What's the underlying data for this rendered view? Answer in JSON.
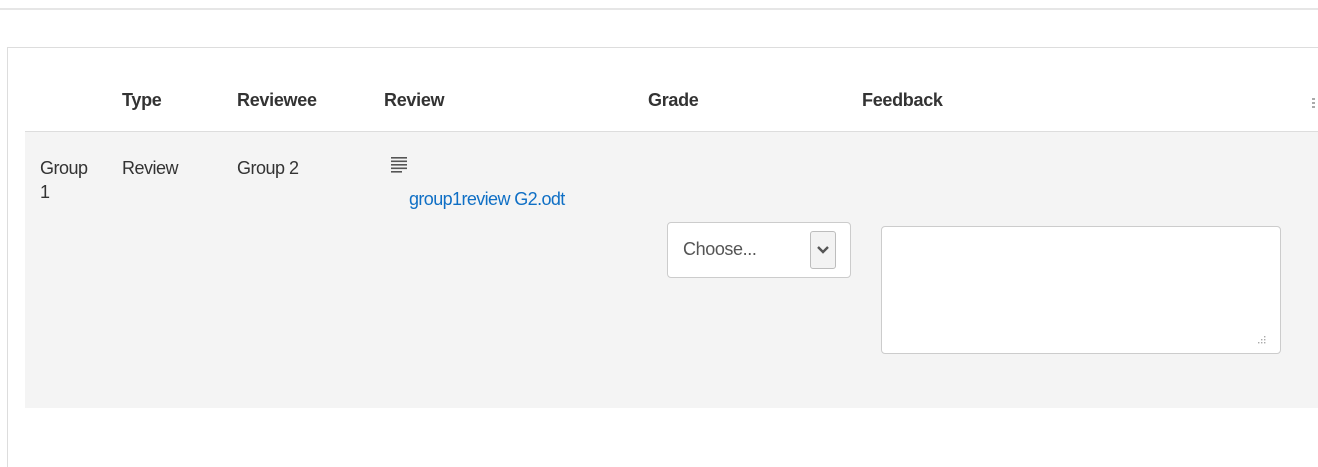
{
  "table": {
    "headers": {
      "type": "Type",
      "reviewee": "Reviewee",
      "review": "Review",
      "grade": "Grade",
      "feedback": "Feedback"
    },
    "rows": [
      {
        "group": "Group 1",
        "type": "Review",
        "reviewee": "Group 2",
        "review_icon": "document-lines-icon",
        "review_file": "group1review G2.odt",
        "grade_selected": "Choose...",
        "feedback_value": ""
      }
    ]
  },
  "colors": {
    "link": "#0f6fc5",
    "row_background": "#f4f4f4",
    "border": "#cccccc"
  }
}
